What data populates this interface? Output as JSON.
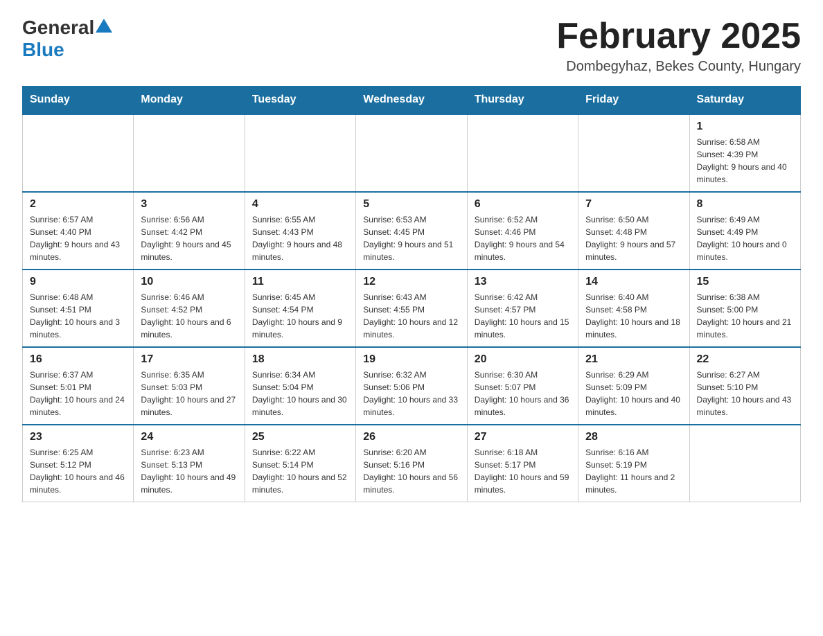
{
  "header": {
    "logo_general": "General",
    "logo_blue": "Blue",
    "month_title": "February 2025",
    "subtitle": "Dombegyhaz, Bekes County, Hungary"
  },
  "weekdays": [
    "Sunday",
    "Monday",
    "Tuesday",
    "Wednesday",
    "Thursday",
    "Friday",
    "Saturday"
  ],
  "weeks": [
    [
      {
        "day": "",
        "sunrise": "",
        "sunset": "",
        "daylight": ""
      },
      {
        "day": "",
        "sunrise": "",
        "sunset": "",
        "daylight": ""
      },
      {
        "day": "",
        "sunrise": "",
        "sunset": "",
        "daylight": ""
      },
      {
        "day": "",
        "sunrise": "",
        "sunset": "",
        "daylight": ""
      },
      {
        "day": "",
        "sunrise": "",
        "sunset": "",
        "daylight": ""
      },
      {
        "day": "",
        "sunrise": "",
        "sunset": "",
        "daylight": ""
      },
      {
        "day": "1",
        "sunrise": "Sunrise: 6:58 AM",
        "sunset": "Sunset: 4:39 PM",
        "daylight": "Daylight: 9 hours and 40 minutes."
      }
    ],
    [
      {
        "day": "2",
        "sunrise": "Sunrise: 6:57 AM",
        "sunset": "Sunset: 4:40 PM",
        "daylight": "Daylight: 9 hours and 43 minutes."
      },
      {
        "day": "3",
        "sunrise": "Sunrise: 6:56 AM",
        "sunset": "Sunset: 4:42 PM",
        "daylight": "Daylight: 9 hours and 45 minutes."
      },
      {
        "day": "4",
        "sunrise": "Sunrise: 6:55 AM",
        "sunset": "Sunset: 4:43 PM",
        "daylight": "Daylight: 9 hours and 48 minutes."
      },
      {
        "day": "5",
        "sunrise": "Sunrise: 6:53 AM",
        "sunset": "Sunset: 4:45 PM",
        "daylight": "Daylight: 9 hours and 51 minutes."
      },
      {
        "day": "6",
        "sunrise": "Sunrise: 6:52 AM",
        "sunset": "Sunset: 4:46 PM",
        "daylight": "Daylight: 9 hours and 54 minutes."
      },
      {
        "day": "7",
        "sunrise": "Sunrise: 6:50 AM",
        "sunset": "Sunset: 4:48 PM",
        "daylight": "Daylight: 9 hours and 57 minutes."
      },
      {
        "day": "8",
        "sunrise": "Sunrise: 6:49 AM",
        "sunset": "Sunset: 4:49 PM",
        "daylight": "Daylight: 10 hours and 0 minutes."
      }
    ],
    [
      {
        "day": "9",
        "sunrise": "Sunrise: 6:48 AM",
        "sunset": "Sunset: 4:51 PM",
        "daylight": "Daylight: 10 hours and 3 minutes."
      },
      {
        "day": "10",
        "sunrise": "Sunrise: 6:46 AM",
        "sunset": "Sunset: 4:52 PM",
        "daylight": "Daylight: 10 hours and 6 minutes."
      },
      {
        "day": "11",
        "sunrise": "Sunrise: 6:45 AM",
        "sunset": "Sunset: 4:54 PM",
        "daylight": "Daylight: 10 hours and 9 minutes."
      },
      {
        "day": "12",
        "sunrise": "Sunrise: 6:43 AM",
        "sunset": "Sunset: 4:55 PM",
        "daylight": "Daylight: 10 hours and 12 minutes."
      },
      {
        "day": "13",
        "sunrise": "Sunrise: 6:42 AM",
        "sunset": "Sunset: 4:57 PM",
        "daylight": "Daylight: 10 hours and 15 minutes."
      },
      {
        "day": "14",
        "sunrise": "Sunrise: 6:40 AM",
        "sunset": "Sunset: 4:58 PM",
        "daylight": "Daylight: 10 hours and 18 minutes."
      },
      {
        "day": "15",
        "sunrise": "Sunrise: 6:38 AM",
        "sunset": "Sunset: 5:00 PM",
        "daylight": "Daylight: 10 hours and 21 minutes."
      }
    ],
    [
      {
        "day": "16",
        "sunrise": "Sunrise: 6:37 AM",
        "sunset": "Sunset: 5:01 PM",
        "daylight": "Daylight: 10 hours and 24 minutes."
      },
      {
        "day": "17",
        "sunrise": "Sunrise: 6:35 AM",
        "sunset": "Sunset: 5:03 PM",
        "daylight": "Daylight: 10 hours and 27 minutes."
      },
      {
        "day": "18",
        "sunrise": "Sunrise: 6:34 AM",
        "sunset": "Sunset: 5:04 PM",
        "daylight": "Daylight: 10 hours and 30 minutes."
      },
      {
        "day": "19",
        "sunrise": "Sunrise: 6:32 AM",
        "sunset": "Sunset: 5:06 PM",
        "daylight": "Daylight: 10 hours and 33 minutes."
      },
      {
        "day": "20",
        "sunrise": "Sunrise: 6:30 AM",
        "sunset": "Sunset: 5:07 PM",
        "daylight": "Daylight: 10 hours and 36 minutes."
      },
      {
        "day": "21",
        "sunrise": "Sunrise: 6:29 AM",
        "sunset": "Sunset: 5:09 PM",
        "daylight": "Daylight: 10 hours and 40 minutes."
      },
      {
        "day": "22",
        "sunrise": "Sunrise: 6:27 AM",
        "sunset": "Sunset: 5:10 PM",
        "daylight": "Daylight: 10 hours and 43 minutes."
      }
    ],
    [
      {
        "day": "23",
        "sunrise": "Sunrise: 6:25 AM",
        "sunset": "Sunset: 5:12 PM",
        "daylight": "Daylight: 10 hours and 46 minutes."
      },
      {
        "day": "24",
        "sunrise": "Sunrise: 6:23 AM",
        "sunset": "Sunset: 5:13 PM",
        "daylight": "Daylight: 10 hours and 49 minutes."
      },
      {
        "day": "25",
        "sunrise": "Sunrise: 6:22 AM",
        "sunset": "Sunset: 5:14 PM",
        "daylight": "Daylight: 10 hours and 52 minutes."
      },
      {
        "day": "26",
        "sunrise": "Sunrise: 6:20 AM",
        "sunset": "Sunset: 5:16 PM",
        "daylight": "Daylight: 10 hours and 56 minutes."
      },
      {
        "day": "27",
        "sunrise": "Sunrise: 6:18 AM",
        "sunset": "Sunset: 5:17 PM",
        "daylight": "Daylight: 10 hours and 59 minutes."
      },
      {
        "day": "28",
        "sunrise": "Sunrise: 6:16 AM",
        "sunset": "Sunset: 5:19 PM",
        "daylight": "Daylight: 11 hours and 2 minutes."
      },
      {
        "day": "",
        "sunrise": "",
        "sunset": "",
        "daylight": ""
      }
    ]
  ]
}
